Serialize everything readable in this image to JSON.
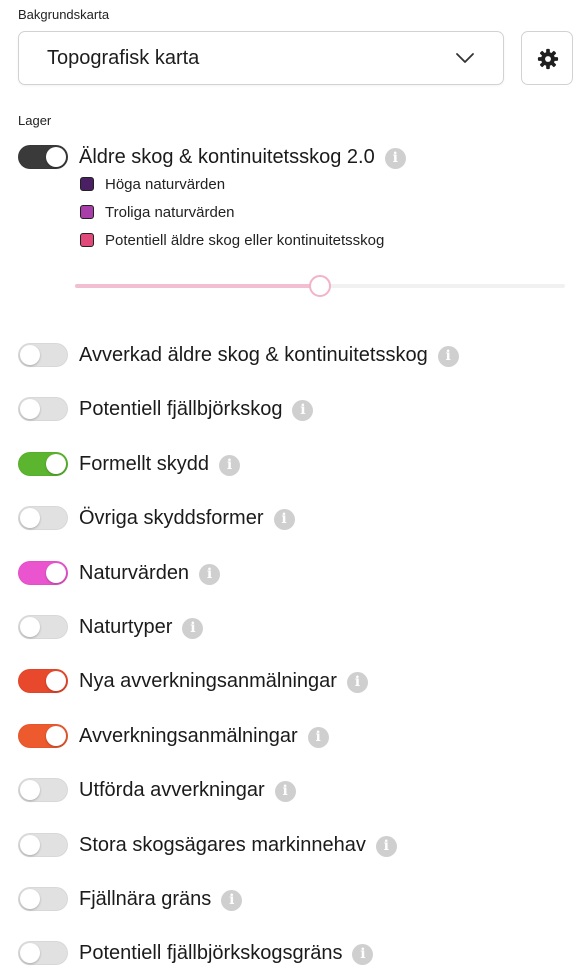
{
  "basemap": {
    "label": "Bakgrundskarta",
    "selected": "Topografisk karta",
    "chevron_icon": "chevron-down-icon",
    "settings_icon": "gear-icon"
  },
  "layers_label": "Lager",
  "primary_layer": {
    "name": "Äldre skog & kontinuitetsskog 2.0",
    "enabled": true,
    "toggle_color": "#3a3a3a",
    "legend": [
      {
        "label": "Höga naturvärden",
        "color": "#4a1f63"
      },
      {
        "label": "Troliga naturvärden",
        "color": "#a83ea9"
      },
      {
        "label": "Potentiell äldre skog eller kontinuitetsskog",
        "color": "#e1497a"
      }
    ],
    "opacity_fraction": 0.5
  },
  "layers": [
    {
      "id": "avverkad",
      "name": "Avverkad äldre skog & kontinuitetsskog",
      "enabled": false,
      "color": "#e1e1e1"
    },
    {
      "id": "fjallbjork",
      "name": "Potentiell fjällbjörkskog",
      "enabled": false,
      "color": "#e1e1e1"
    },
    {
      "id": "formellt",
      "name": "Formellt skydd",
      "enabled": true,
      "color": "#5cb52f"
    },
    {
      "id": "ovriga",
      "name": "Övriga skyddsformer",
      "enabled": false,
      "color": "#e1e1e1"
    },
    {
      "id": "naturvarden",
      "name": "Naturvärden",
      "enabled": true,
      "color": "#ea55cf"
    },
    {
      "id": "naturtyper",
      "name": "Naturtyper",
      "enabled": false,
      "color": "#e1e1e1"
    },
    {
      "id": "nya-avverkning",
      "name": "Nya avverkningsanmälningar",
      "enabled": true,
      "color": "#e8492c"
    },
    {
      "id": "avverkning",
      "name": "Avverkningsanmälningar",
      "enabled": true,
      "color": "#ec5a2e"
    },
    {
      "id": "utforda",
      "name": "Utförda avverkningar",
      "enabled": false,
      "color": "#e1e1e1"
    },
    {
      "id": "stora",
      "name": "Stora skogsägares markinnehav",
      "enabled": false,
      "color": "#e1e1e1"
    },
    {
      "id": "fjallnara",
      "name": "Fjällnära gräns",
      "enabled": false,
      "color": "#e1e1e1"
    },
    {
      "id": "fjallbjorkgrans",
      "name": "Potentiell fjällbjörkskogsgräns",
      "enabled": false,
      "color": "#e1e1e1"
    }
  ],
  "info_icon": "info-icon"
}
